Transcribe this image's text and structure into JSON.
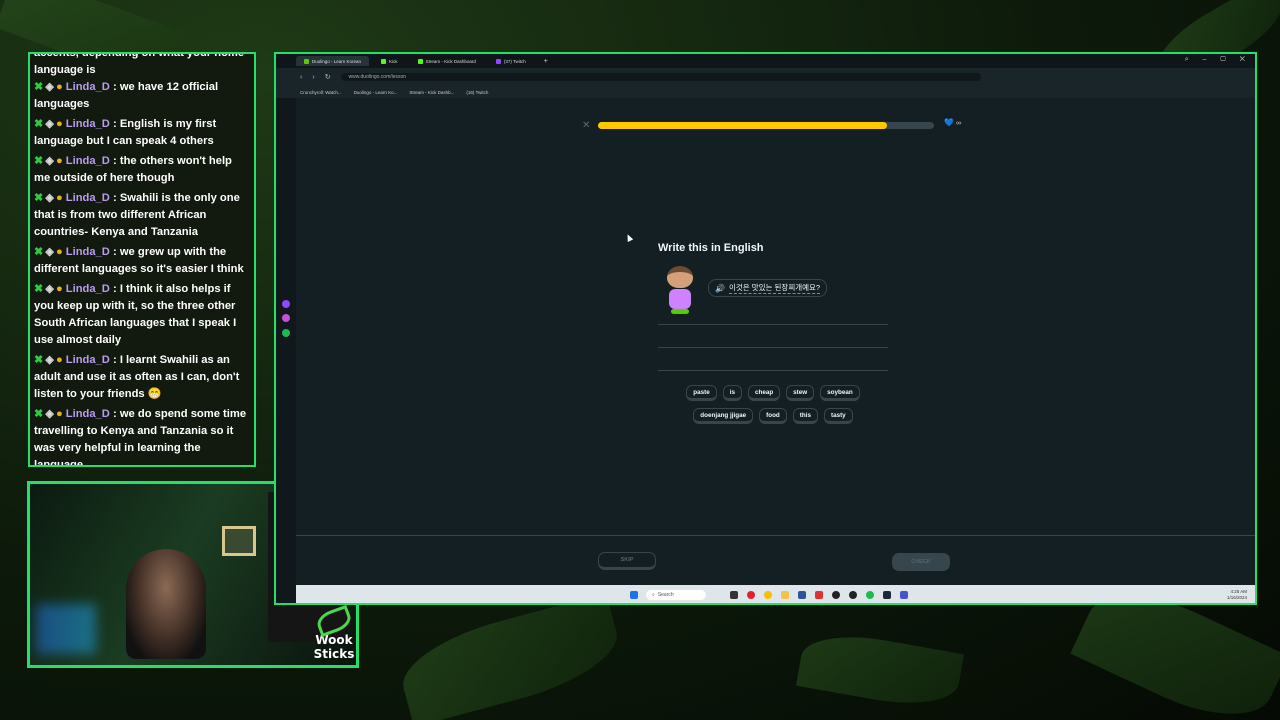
{
  "chat": {
    "partial_top": "accents, depending on what your home language is",
    "messages": [
      {
        "user": "Linda_D",
        "text": "we have 12 official languages"
      },
      {
        "user": "Linda_D",
        "text": "English is my first language but I can speak 4 others"
      },
      {
        "user": "Linda_D",
        "text": "the others won't help me outside of here though"
      },
      {
        "user": "Linda_D",
        "text": "Swahili is the only one that is from two different African countries- Kenya and Tanzania"
      },
      {
        "user": "Linda_D",
        "text": "we grew up with the different languages so it's easier I think"
      },
      {
        "user": "Linda_D",
        "text": "I think it also helps if you keep up with it, so the three other South African languages that I speak I use almost daily"
      },
      {
        "user": "Linda_D",
        "text": "I learnt Swahili as an adult and use it as often as I can, don't listen to your friends 😁"
      },
      {
        "user": "Linda_D",
        "text": "we do spend some time travelling to Kenya and Tanzania so it was very helpful in learning the language"
      }
    ],
    "separator": ":"
  },
  "webcam": {
    "logo_line1": "Wook",
    "logo_line2": "Sticks"
  },
  "browser": {
    "tabs": [
      {
        "label": "Duolingo - Learn Korean",
        "color": "#58cc02",
        "active": true
      },
      {
        "label": "Kick",
        "color": "#53fc18",
        "active": false
      },
      {
        "label": "Stream - Kick Dashboard",
        "color": "#53fc18",
        "active": false
      },
      {
        "label": "(37) Twitch",
        "color": "#9146ff",
        "active": false
      }
    ],
    "new_tab": "+",
    "url": "www.duolingo.com/lesson",
    "bookmarks": [
      "Crunchyroll: Watch...",
      "Duolingo - Learn Ko...",
      "Stream - Kick Dashb...",
      "(16) Twitch"
    ]
  },
  "lesson": {
    "progress": 0.86,
    "close_icon": "✕",
    "hearts_icon": "💙",
    "hearts_label": "∞",
    "prompt_title": "Write this in English",
    "speaker_icon": "🔊",
    "korean_sentence": "이것은 맛있는 된장찌개예요?",
    "word_bank_row1": [
      "paste",
      "is",
      "cheap",
      "stew",
      "soybean"
    ],
    "word_bank_row2": [
      "doenjang jjigae",
      "food",
      "this",
      "tasty"
    ],
    "skip_label": "SKIP",
    "check_label": "CHECK"
  },
  "taskbar": {
    "search_placeholder": "Search",
    "tray_time": "4:25 AM",
    "tray_date": "1/16/2024"
  },
  "colors": {
    "accent_green": "#22e06a",
    "duolingo_bg": "#131f23",
    "progress_yellow": "#ffc800",
    "chat_username": "#b99bf0"
  }
}
